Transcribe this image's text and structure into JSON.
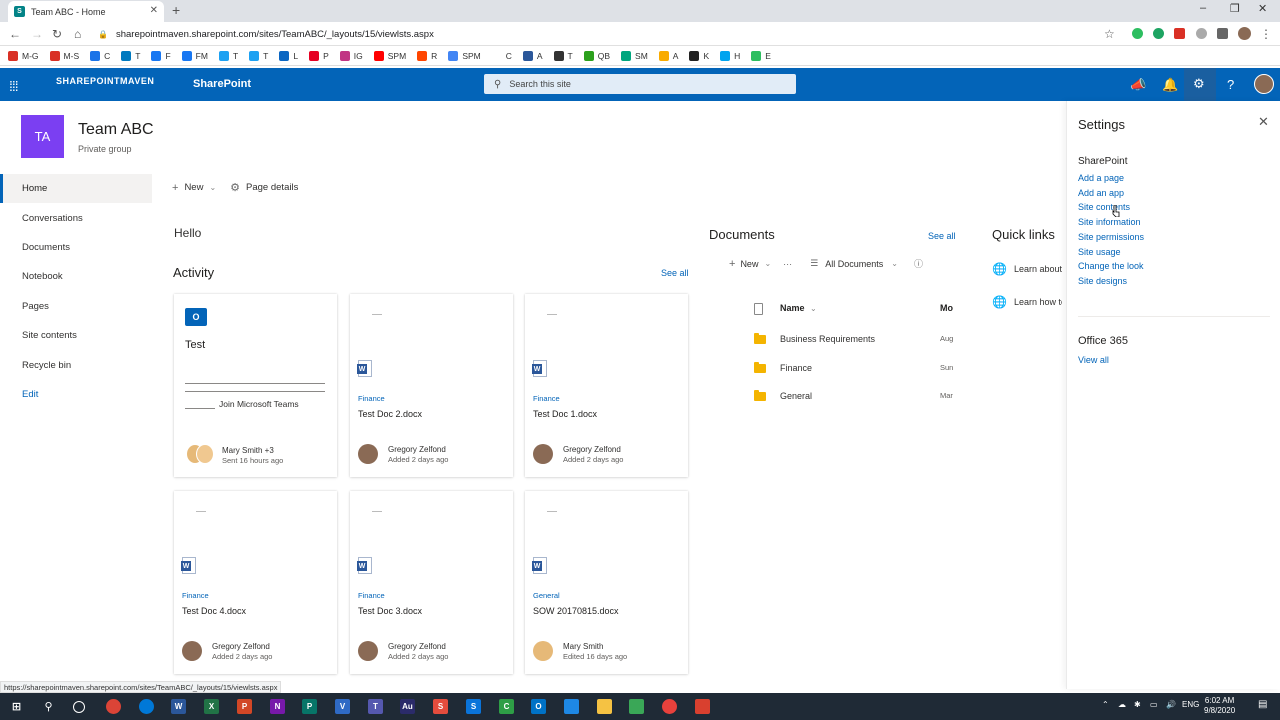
{
  "browser": {
    "tab_title": "Team ABC - Home",
    "url": "sharepointmaven.sharepoint.com/sites/TeamABC/_layouts/15/viewlsts.aspx",
    "status_url": "https://sharepointmaven.sharepoint.com/sites/TeamABC/_layouts/15/viewlsts.aspx",
    "bookmarks": [
      {
        "label": "M-G",
        "color": "#d93025"
      },
      {
        "label": "M-S",
        "color": "#d93025"
      },
      {
        "label": "C",
        "color": "#1a73e8"
      },
      {
        "label": "T",
        "color": "#0079bf"
      },
      {
        "label": "F",
        "color": "#1877f2"
      },
      {
        "label": "FM",
        "color": "#1877f2"
      },
      {
        "label": "T",
        "color": "#1da1f2"
      },
      {
        "label": "T",
        "color": "#1da1f2"
      },
      {
        "label": "L",
        "color": "#0a66c2"
      },
      {
        "label": "P",
        "color": "#e60023"
      },
      {
        "label": "IG",
        "color": "#c13584"
      },
      {
        "label": "SPM",
        "color": "#ff0000"
      },
      {
        "label": "R",
        "color": "#ff4500"
      },
      {
        "label": "SPM",
        "color": "#4285f4"
      },
      {
        "label": "C",
        "color": "#ffffff"
      },
      {
        "label": "A",
        "color": "#2b579a"
      },
      {
        "label": "T",
        "color": "#333333"
      },
      {
        "label": "QB",
        "color": "#2ca01c"
      },
      {
        "label": "SM",
        "color": "#00a67e"
      },
      {
        "label": "A",
        "color": "#f9ab00"
      },
      {
        "label": "K",
        "color": "#222222"
      },
      {
        "label": "H",
        "color": "#00a4ef"
      },
      {
        "label": "E",
        "color": "#2dbe60"
      }
    ]
  },
  "suitebar": {
    "app_name": "SharePoint",
    "logo_text": "SHAREPOINTMAVEN",
    "search_placeholder": "Search this site"
  },
  "site": {
    "logo_initials": "TA",
    "title": "Team ABC",
    "subtitle": "Private group"
  },
  "leftnav": [
    {
      "label": "Home",
      "active": true
    },
    {
      "label": "Conversations"
    },
    {
      "label": "Documents"
    },
    {
      "label": "Notebook"
    },
    {
      "label": "Pages"
    },
    {
      "label": "Site contents"
    },
    {
      "label": "Recycle bin"
    },
    {
      "label": "Edit",
      "edit": true
    }
  ],
  "command_bar": {
    "new_label": "New",
    "page_details_label": "Page details"
  },
  "hello": "Hello",
  "activity": {
    "heading": "Activity",
    "see_all": "See all",
    "card1": {
      "title": "Test",
      "join_text": "Join Microsoft Teams",
      "author": "Mary Smith +3",
      "when": "Sent 16 hours ago"
    },
    "cards": [
      {
        "library": "Finance",
        "file": "Test Doc 2.docx",
        "author": "Gregory Zelfond",
        "when": "Added 2 days ago"
      },
      {
        "library": "Finance",
        "file": "Test Doc 1.docx",
        "author": "Gregory Zelfond",
        "when": "Added 2 days ago"
      },
      {
        "library": "Finance",
        "file": "Test Doc 4.docx",
        "author": "Gregory Zelfond",
        "when": "Added 2 days ago"
      },
      {
        "library": "Finance",
        "file": "Test Doc 3.docx",
        "author": "Gregory Zelfond",
        "when": "Added 2 days ago"
      },
      {
        "library": "General",
        "file": "SOW 20170815.docx",
        "author": "Mary Smith",
        "when": "Edited 16 days ago"
      }
    ]
  },
  "documents": {
    "heading": "Documents",
    "see_all": "See all",
    "new_label": "New",
    "more_label": "···",
    "view_label": "All Documents",
    "col_name": "Name",
    "col_modified": "Mo",
    "rows": [
      {
        "name": "Business Requirements",
        "modified": "Aug"
      },
      {
        "name": "Finance",
        "modified": "Sun"
      },
      {
        "name": "General",
        "modified": "Mar"
      }
    ]
  },
  "quick_links": {
    "heading": "Quick links",
    "items": [
      "Learn about",
      "Learn how to"
    ]
  },
  "settings": {
    "title": "Settings",
    "sharepoint_heading": "SharePoint",
    "links": [
      "Add a page",
      "Add an app",
      "Site contents",
      "Site information",
      "Site permissions",
      "Site usage",
      "Change the look",
      "Site designs"
    ],
    "office_heading": "Office 365",
    "view_all": "View all"
  },
  "taskbar": {
    "lang": "ENG",
    "time": "6:02 AM",
    "date": "9/8/2020"
  }
}
